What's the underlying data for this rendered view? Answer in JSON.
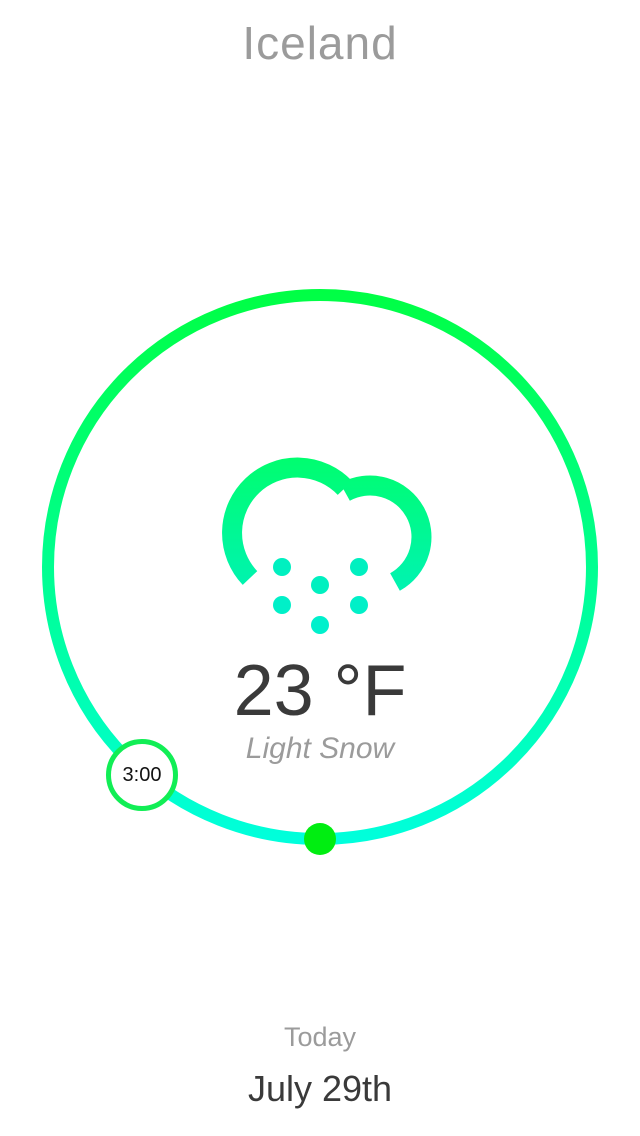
{
  "header": {
    "location": "Iceland"
  },
  "weather": {
    "temperature": "23 °F",
    "condition": "Light Snow",
    "icon": "snow-cloud-icon"
  },
  "timeline": {
    "selected_time": "3:00"
  },
  "footer": {
    "day": "Today",
    "date": "July 29th"
  },
  "colors": {
    "ring_top": "#00ff44",
    "ring_bottom": "#00ffdd",
    "handle": "#00ee11",
    "text_dark": "#3a3a3a",
    "text_muted": "#9b9b9b"
  }
}
